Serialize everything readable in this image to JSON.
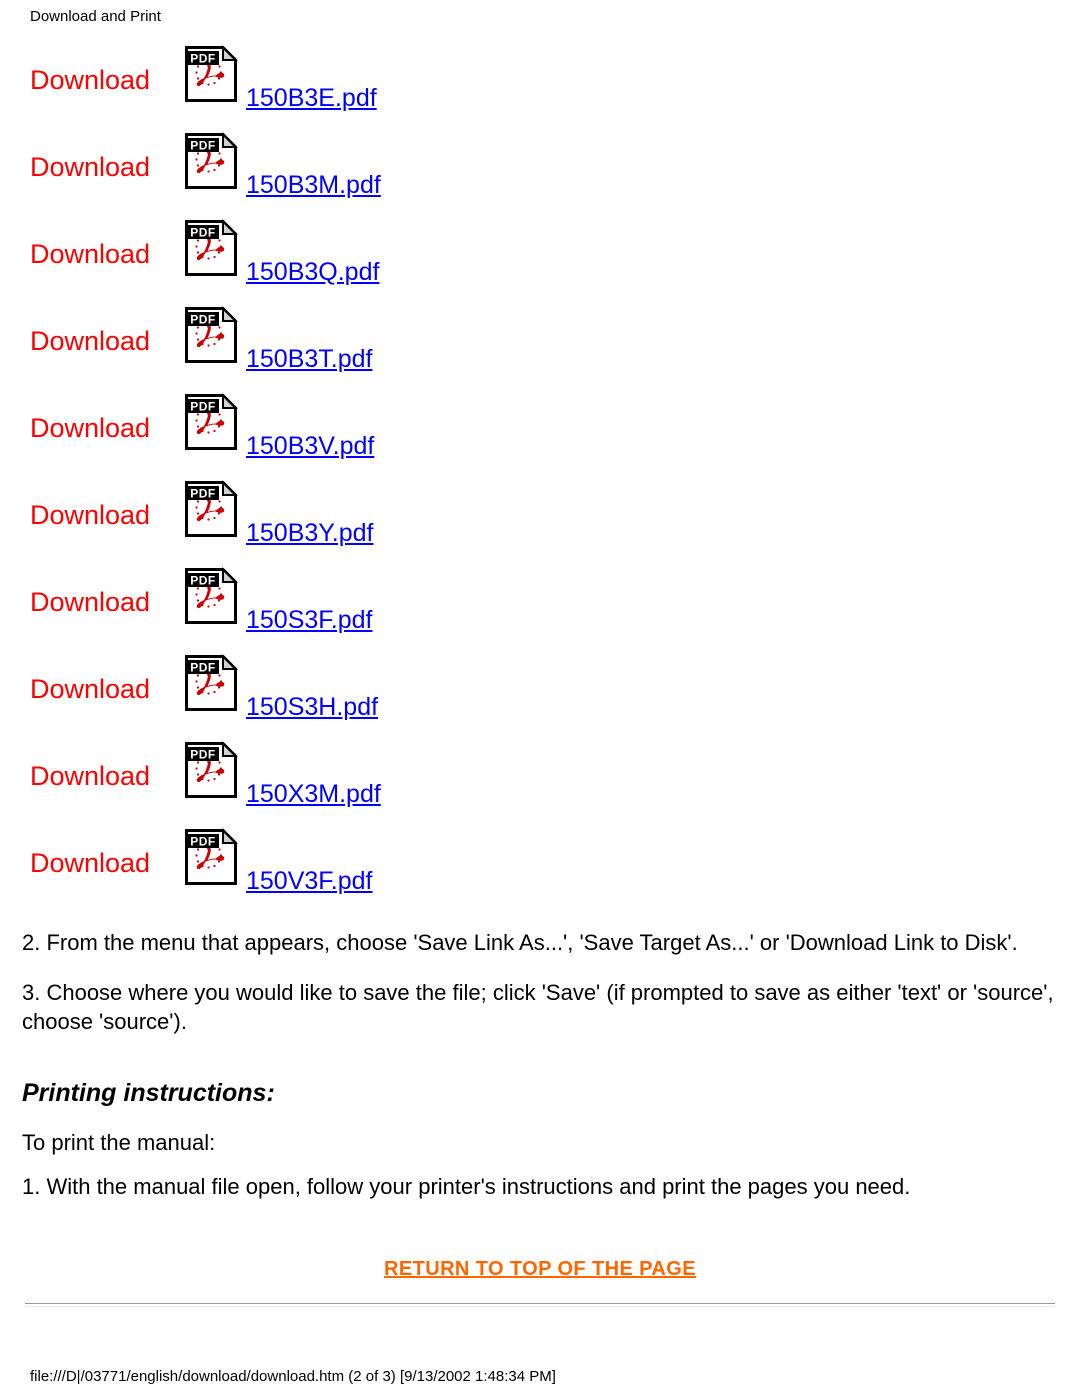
{
  "header": {
    "title": "Download and Print"
  },
  "downloads": {
    "icon_name": "pdf-file-icon",
    "icon_badge_text": "PDF",
    "items": [
      {
        "label": "Download",
        "filename": "150B3E.pdf"
      },
      {
        "label": "Download",
        "filename": "150B3M.pdf"
      },
      {
        "label": "Download",
        "filename": "150B3Q.pdf"
      },
      {
        "label": "Download",
        "filename": "150B3T.pdf"
      },
      {
        "label": "Download",
        "filename": "150B3V.pdf"
      },
      {
        "label": "Download",
        "filename": "150B3Y.pdf"
      },
      {
        "label": "Download",
        "filename": "150S3F.pdf"
      },
      {
        "label": "Download",
        "filename": "150S3H.pdf"
      },
      {
        "label": "Download",
        "filename": "150X3M.pdf"
      },
      {
        "label": "Download",
        "filename": "150V3F.pdf"
      }
    ]
  },
  "instructions": {
    "step2": "2. From the menu that appears, choose 'Save Link As...', 'Save Target As...' or 'Download Link to Disk'.",
    "step3": "3. Choose where you would like to save the file; click 'Save' (if prompted to save as either 'text' or 'source', choose 'source')."
  },
  "printing": {
    "title": "Printing instructions:",
    "lead": "To print the manual:",
    "step1": "1. With the manual file open, follow your printer's instructions and print the pages you need."
  },
  "footer": {
    "return_to_top": "RETURN TO TOP OF THE PAGE",
    "path": "file:///D|/03771/english/download/download.htm (2 of 3) [9/13/2002 1:48:34 PM]"
  },
  "colors": {
    "download_label": "#ff0000",
    "file_link": "#0000ff",
    "return_link": "#ff6600",
    "text": "#000000",
    "background": "#ffffff"
  }
}
